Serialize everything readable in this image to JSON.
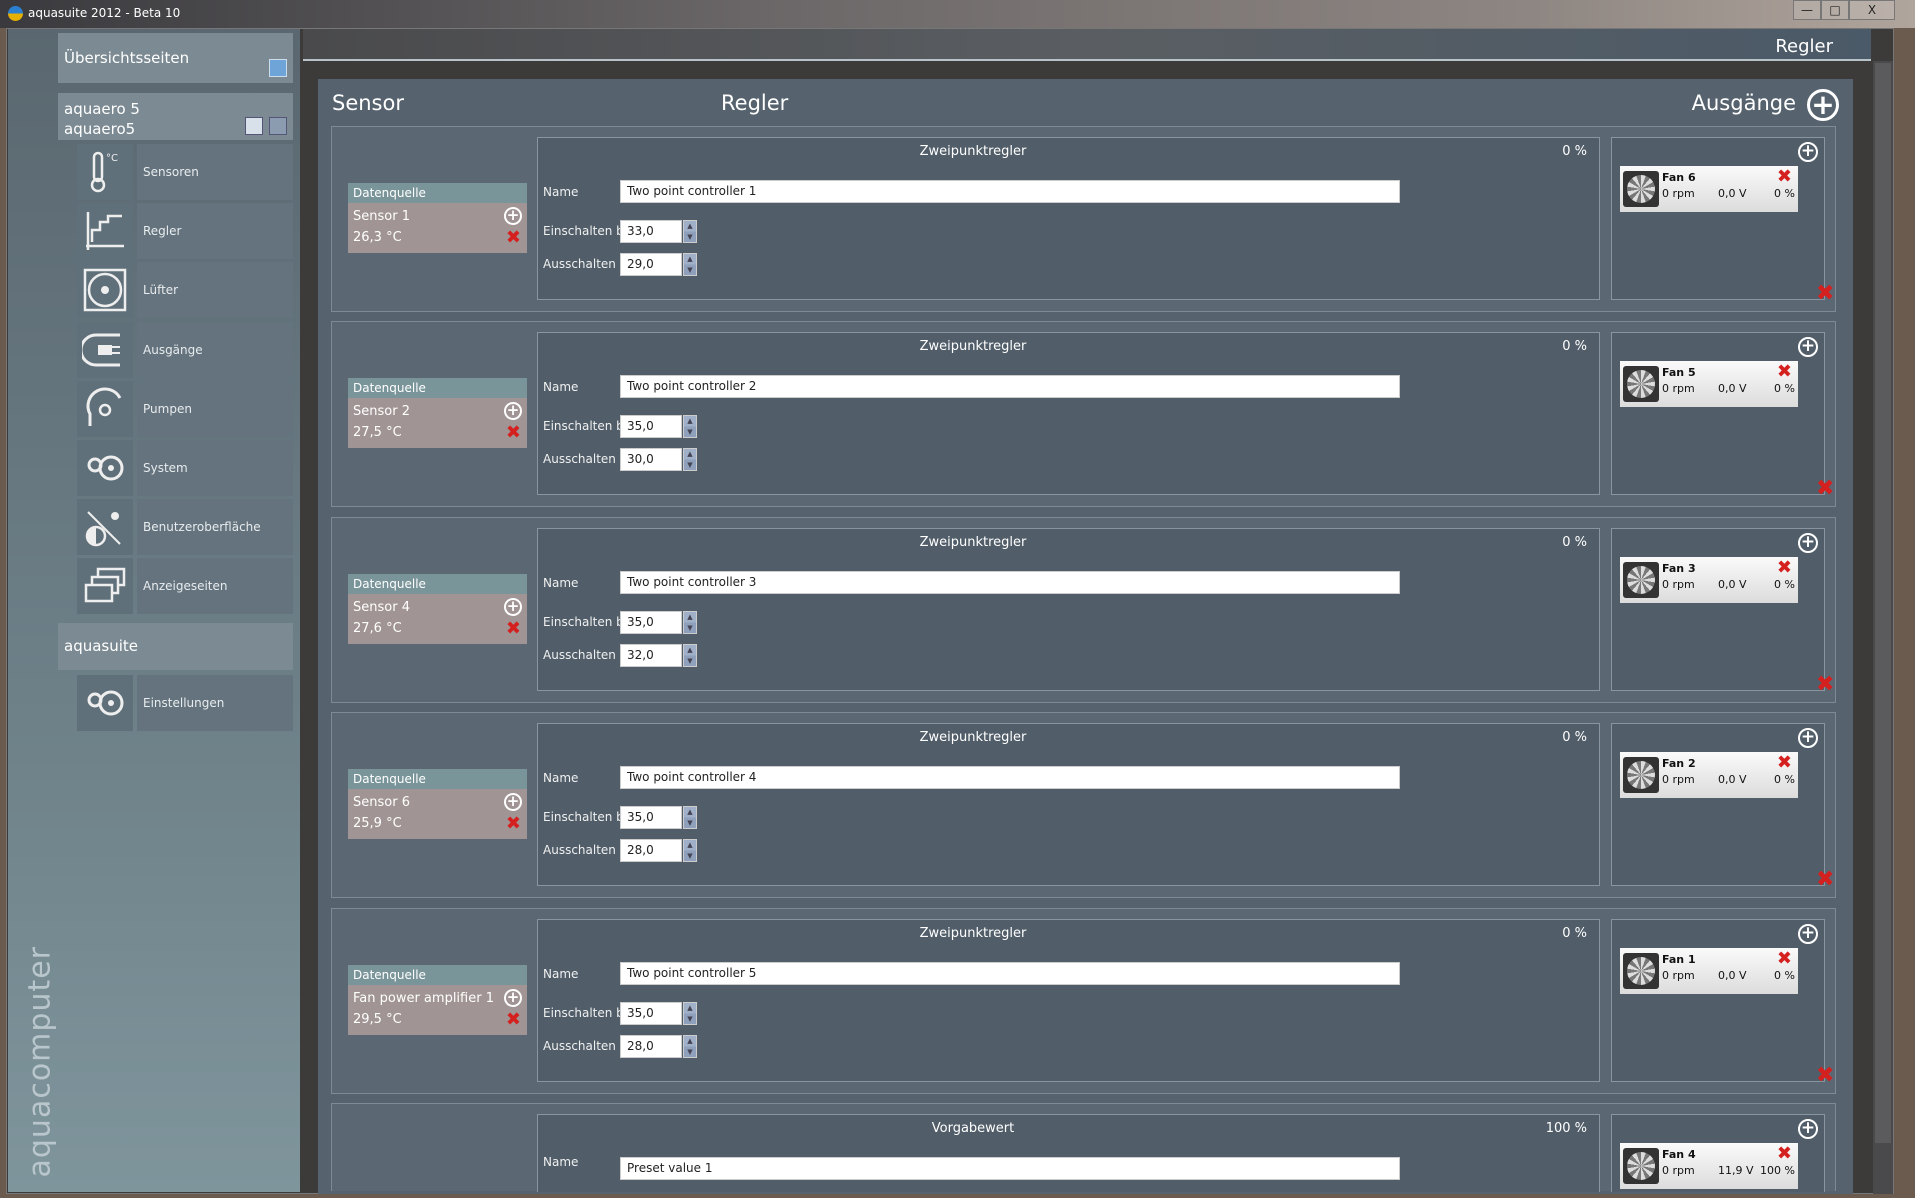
{
  "window": {
    "title": "aquasuite 2012 - Beta 10",
    "min": "—",
    "max": "□",
    "close": "X"
  },
  "sidebar": {
    "overview": "Übersichtsseiten",
    "device_line1": "aquaero 5",
    "device_line2": "aquaero5",
    "items": [
      {
        "label": "Sensoren",
        "icon": "thermometer-icon"
      },
      {
        "label": "Regler",
        "icon": "controller-icon"
      },
      {
        "label": "Lüfter",
        "icon": "fan-icon"
      },
      {
        "label": "Ausgänge",
        "icon": "output-plug-icon"
      },
      {
        "label": "Pumpen",
        "icon": "pump-icon"
      },
      {
        "label": "System",
        "icon": "system-gears-icon"
      },
      {
        "label": "Benutzeroberfläche",
        "icon": "display-brightness-icon"
      },
      {
        "label": "Anzeigeseiten",
        "icon": "pages-icon"
      }
    ],
    "aquasuite": "aquasuite",
    "settings": {
      "label": "Einstellungen",
      "icon": "system-gears-icon"
    },
    "brand": "aquacomputer"
  },
  "header": {
    "page_title": "Regler",
    "col_sensor": "Sensor",
    "col_controller": "Regler",
    "col_outputs": "Ausgänge"
  },
  "labels": {
    "datasource": "Datenquelle",
    "name": "Name",
    "on_at": "Einschalten bei",
    "off_at": "Ausschalten bei"
  },
  "rows": [
    {
      "type": "Zweipunktregler",
      "percent": "0 %",
      "sensor": "Sensor 1",
      "temp": "26,3 °C",
      "name": "Two point controller 1",
      "on": "33,0",
      "off": "29,0",
      "fan": {
        "name": "Fan 6",
        "rpm": "0 rpm",
        "volt": "0,0 V",
        "pct": "0 %"
      }
    },
    {
      "type": "Zweipunktregler",
      "percent": "0 %",
      "sensor": "Sensor 2",
      "temp": "27,5 °C",
      "name": "Two point controller 2",
      "on": "35,0",
      "off": "30,0",
      "fan": {
        "name": "Fan 5",
        "rpm": "0 rpm",
        "volt": "0,0 V",
        "pct": "0 %"
      }
    },
    {
      "type": "Zweipunktregler",
      "percent": "0 %",
      "sensor": "Sensor 4",
      "temp": "27,6 °C",
      "name": "Two point controller 3",
      "on": "35,0",
      "off": "32,0",
      "fan": {
        "name": "Fan 3",
        "rpm": "0 rpm",
        "volt": "0,0 V",
        "pct": "0 %"
      }
    },
    {
      "type": "Zweipunktregler",
      "percent": "0 %",
      "sensor": "Sensor 6",
      "temp": "25,9 °C",
      "name": "Two point controller 4",
      "on": "35,0",
      "off": "28,0",
      "fan": {
        "name": "Fan 2",
        "rpm": "0 rpm",
        "volt": "0,0 V",
        "pct": "0 %"
      }
    },
    {
      "type": "Zweipunktregler",
      "percent": "0 %",
      "sensor": "Fan power amplifier 1",
      "temp": "29,5 °C",
      "name": "Two point controller 5",
      "on": "35,0",
      "off": "28,0",
      "fan": {
        "name": "Fan 1",
        "rpm": "0 rpm",
        "volt": "0,0 V",
        "pct": "0 %"
      }
    },
    {
      "type": "Vorgabewert",
      "percent": "100 %",
      "name": "Preset value 1",
      "fan": {
        "name": "Fan 4",
        "rpm": "0 rpm",
        "volt": "11,9 V",
        "pct": "100 %"
      }
    }
  ]
}
